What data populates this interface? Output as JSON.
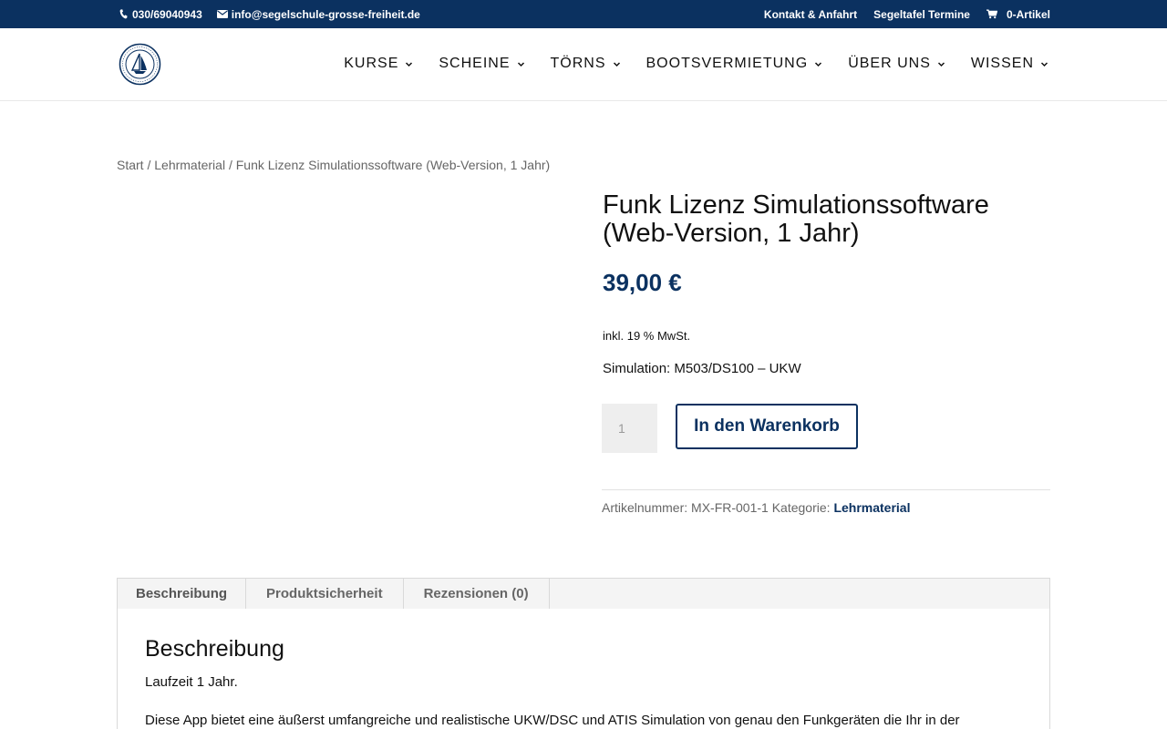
{
  "topbar": {
    "phone": "030/69040943",
    "email": "info@segelschule-grosse-freiheit.de",
    "links": [
      "Kontakt & Anfahrt",
      "Segeltafel Termine"
    ],
    "cart": "0-Artikel"
  },
  "nav": {
    "items": [
      "KURSE",
      "SCHEINE",
      "TÖRNS",
      "BOOTSVERMIETUNG",
      "ÜBER UNS",
      "WISSEN"
    ]
  },
  "breadcrumb": {
    "home": "Start",
    "category": "Lehrmaterial",
    "current": "Funk Lizenz Simulationssoftware (Web-Version, 1 Jahr)",
    "separator": " / "
  },
  "product": {
    "title": "Funk Lizenz Simulationssoftware (Web-Version, 1 Jahr)",
    "price": "39,00 €",
    "tax_note": "inkl. 19 % MwSt.",
    "variant": "Simulation: M503/DS100 – UKW",
    "quantity": "1",
    "add_to_cart": "In den Warenkorb",
    "sku_label": "Artikelnummer:",
    "sku": "MX-FR-001-1",
    "category_label": "Kategorie:",
    "category": "Lehrmaterial"
  },
  "tabs": {
    "items": [
      "Beschreibung",
      "Produktsicherheit",
      "Rezensionen (0)"
    ],
    "panel_title": "Beschreibung",
    "panel_p1": "Laufzeit 1 Jahr.",
    "panel_p2": "Diese App bietet eine äußerst umfangreiche und realistische UKW/DSC und ATIS Simulation von genau den Funkgeräten die Ihr in der"
  },
  "colors": {
    "brand": "#0b3160",
    "text": "#111111",
    "muted": "#666666"
  }
}
